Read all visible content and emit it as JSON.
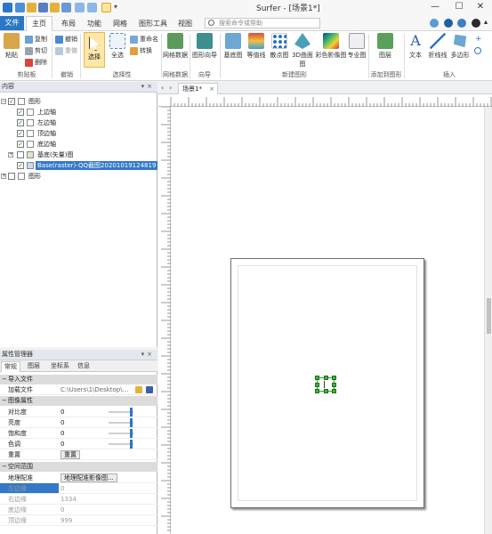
{
  "window": {
    "title": "Surfer - [场景1*]",
    "minimize": "—",
    "maximize": "☐",
    "close": "✕"
  },
  "menu": {
    "tabs": [
      "文件",
      "主页",
      "布局",
      "功能",
      "网格",
      "图形工具",
      "视图"
    ],
    "search_placeholder": "搜索命令或帮助"
  },
  "ribbon": {
    "clipboard": {
      "paste": "粘贴",
      "copy": "复制",
      "cut": "剪切",
      "delete": "删除",
      "label": "剪贴板"
    },
    "undo": {
      "undo": "撤销",
      "redo": "重做",
      "label": "撤销"
    },
    "selection": {
      "select": "选择",
      "select_all": "全选",
      "rename": "重命名",
      "convert": "转换",
      "label": "选择性"
    },
    "grid_data": {
      "button": "网格数据",
      "label": "网格数据"
    },
    "wizard": {
      "button": "图形向导",
      "label": "向导"
    },
    "new_map": {
      "items": [
        "基底图",
        "等值线",
        "散点图",
        "3D曲面图",
        "彩色影像图",
        "专业图"
      ],
      "label": "新建图形"
    },
    "add_to_map": {
      "button": "图层",
      "label": "添加到图形"
    },
    "insert": {
      "items": [
        "文本",
        "折线线",
        "多边形"
      ],
      "label": "插入"
    }
  },
  "contents_panel": {
    "title": "内容",
    "tree": [
      {
        "label": "图形",
        "checked": true
      },
      {
        "label": "上边轴",
        "checked": true
      },
      {
        "label": "左边轴",
        "checked": true
      },
      {
        "label": "顶边轴",
        "checked": true
      },
      {
        "label": "底边轴",
        "checked": true
      },
      {
        "label": "基底(矢量)图",
        "checked": false
      },
      {
        "label": "Base(raster)-QQ截图20201019124819",
        "checked": true
      },
      {
        "label": "图形",
        "checked": false
      }
    ]
  },
  "property_panel": {
    "title": "属性管理器",
    "tabs": [
      "常规",
      "图层",
      "坐标系",
      "信息"
    ],
    "sections": {
      "import": "导入文件",
      "image": "图像属性",
      "spatial": "空间范围"
    },
    "file": {
      "label": "加载文件",
      "value": "C:\\Users\\1\\Desktop\\..."
    },
    "image_props": [
      {
        "label": "对比度",
        "value": "0"
      },
      {
        "label": "亮度",
        "value": "0"
      },
      {
        "label": "饱和度",
        "value": "0"
      },
      {
        "label": "色调",
        "value": "0"
      }
    ],
    "reset": {
      "label": "重置",
      "button": "重置"
    },
    "georef": {
      "label": "地理配准",
      "button": "地理配准影像图..."
    },
    "spatial_props": [
      {
        "label": "左边缘",
        "value": "0"
      },
      {
        "label": "右边缘",
        "value": "1334"
      },
      {
        "label": "底边缘",
        "value": "0"
      },
      {
        "label": "顶边缘",
        "value": "999"
      }
    ]
  },
  "document": {
    "tab": "场景1*"
  },
  "colors": {
    "accent": "#2b77c5",
    "selection": "#3478c8",
    "handle": "#38b838"
  }
}
